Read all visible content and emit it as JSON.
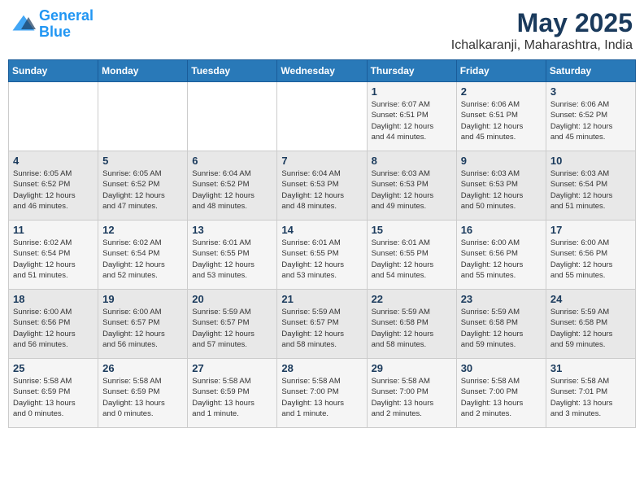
{
  "header": {
    "logo_line1": "General",
    "logo_line2": "Blue",
    "month": "May 2025",
    "location": "Ichalkaranji, Maharashtra, India"
  },
  "weekdays": [
    "Sunday",
    "Monday",
    "Tuesday",
    "Wednesday",
    "Thursday",
    "Friday",
    "Saturday"
  ],
  "weeks": [
    [
      {
        "day": "",
        "info": ""
      },
      {
        "day": "",
        "info": ""
      },
      {
        "day": "",
        "info": ""
      },
      {
        "day": "",
        "info": ""
      },
      {
        "day": "1",
        "info": "Sunrise: 6:07 AM\nSunset: 6:51 PM\nDaylight: 12 hours\nand 44 minutes."
      },
      {
        "day": "2",
        "info": "Sunrise: 6:06 AM\nSunset: 6:51 PM\nDaylight: 12 hours\nand 45 minutes."
      },
      {
        "day": "3",
        "info": "Sunrise: 6:06 AM\nSunset: 6:52 PM\nDaylight: 12 hours\nand 45 minutes."
      }
    ],
    [
      {
        "day": "4",
        "info": "Sunrise: 6:05 AM\nSunset: 6:52 PM\nDaylight: 12 hours\nand 46 minutes."
      },
      {
        "day": "5",
        "info": "Sunrise: 6:05 AM\nSunset: 6:52 PM\nDaylight: 12 hours\nand 47 minutes."
      },
      {
        "day": "6",
        "info": "Sunrise: 6:04 AM\nSunset: 6:52 PM\nDaylight: 12 hours\nand 48 minutes."
      },
      {
        "day": "7",
        "info": "Sunrise: 6:04 AM\nSunset: 6:53 PM\nDaylight: 12 hours\nand 48 minutes."
      },
      {
        "day": "8",
        "info": "Sunrise: 6:03 AM\nSunset: 6:53 PM\nDaylight: 12 hours\nand 49 minutes."
      },
      {
        "day": "9",
        "info": "Sunrise: 6:03 AM\nSunset: 6:53 PM\nDaylight: 12 hours\nand 50 minutes."
      },
      {
        "day": "10",
        "info": "Sunrise: 6:03 AM\nSunset: 6:54 PM\nDaylight: 12 hours\nand 51 minutes."
      }
    ],
    [
      {
        "day": "11",
        "info": "Sunrise: 6:02 AM\nSunset: 6:54 PM\nDaylight: 12 hours\nand 51 minutes."
      },
      {
        "day": "12",
        "info": "Sunrise: 6:02 AM\nSunset: 6:54 PM\nDaylight: 12 hours\nand 52 minutes."
      },
      {
        "day": "13",
        "info": "Sunrise: 6:01 AM\nSunset: 6:55 PM\nDaylight: 12 hours\nand 53 minutes."
      },
      {
        "day": "14",
        "info": "Sunrise: 6:01 AM\nSunset: 6:55 PM\nDaylight: 12 hours\nand 53 minutes."
      },
      {
        "day": "15",
        "info": "Sunrise: 6:01 AM\nSunset: 6:55 PM\nDaylight: 12 hours\nand 54 minutes."
      },
      {
        "day": "16",
        "info": "Sunrise: 6:00 AM\nSunset: 6:56 PM\nDaylight: 12 hours\nand 55 minutes."
      },
      {
        "day": "17",
        "info": "Sunrise: 6:00 AM\nSunset: 6:56 PM\nDaylight: 12 hours\nand 55 minutes."
      }
    ],
    [
      {
        "day": "18",
        "info": "Sunrise: 6:00 AM\nSunset: 6:56 PM\nDaylight: 12 hours\nand 56 minutes."
      },
      {
        "day": "19",
        "info": "Sunrise: 6:00 AM\nSunset: 6:57 PM\nDaylight: 12 hours\nand 56 minutes."
      },
      {
        "day": "20",
        "info": "Sunrise: 5:59 AM\nSunset: 6:57 PM\nDaylight: 12 hours\nand 57 minutes."
      },
      {
        "day": "21",
        "info": "Sunrise: 5:59 AM\nSunset: 6:57 PM\nDaylight: 12 hours\nand 58 minutes."
      },
      {
        "day": "22",
        "info": "Sunrise: 5:59 AM\nSunset: 6:58 PM\nDaylight: 12 hours\nand 58 minutes."
      },
      {
        "day": "23",
        "info": "Sunrise: 5:59 AM\nSunset: 6:58 PM\nDaylight: 12 hours\nand 59 minutes."
      },
      {
        "day": "24",
        "info": "Sunrise: 5:59 AM\nSunset: 6:58 PM\nDaylight: 12 hours\nand 59 minutes."
      }
    ],
    [
      {
        "day": "25",
        "info": "Sunrise: 5:58 AM\nSunset: 6:59 PM\nDaylight: 13 hours\nand 0 minutes."
      },
      {
        "day": "26",
        "info": "Sunrise: 5:58 AM\nSunset: 6:59 PM\nDaylight: 13 hours\nand 0 minutes."
      },
      {
        "day": "27",
        "info": "Sunrise: 5:58 AM\nSunset: 6:59 PM\nDaylight: 13 hours\nand 1 minute."
      },
      {
        "day": "28",
        "info": "Sunrise: 5:58 AM\nSunset: 7:00 PM\nDaylight: 13 hours\nand 1 minute."
      },
      {
        "day": "29",
        "info": "Sunrise: 5:58 AM\nSunset: 7:00 PM\nDaylight: 13 hours\nand 2 minutes."
      },
      {
        "day": "30",
        "info": "Sunrise: 5:58 AM\nSunset: 7:00 PM\nDaylight: 13 hours\nand 2 minutes."
      },
      {
        "day": "31",
        "info": "Sunrise: 5:58 AM\nSunset: 7:01 PM\nDaylight: 13 hours\nand 3 minutes."
      }
    ]
  ]
}
